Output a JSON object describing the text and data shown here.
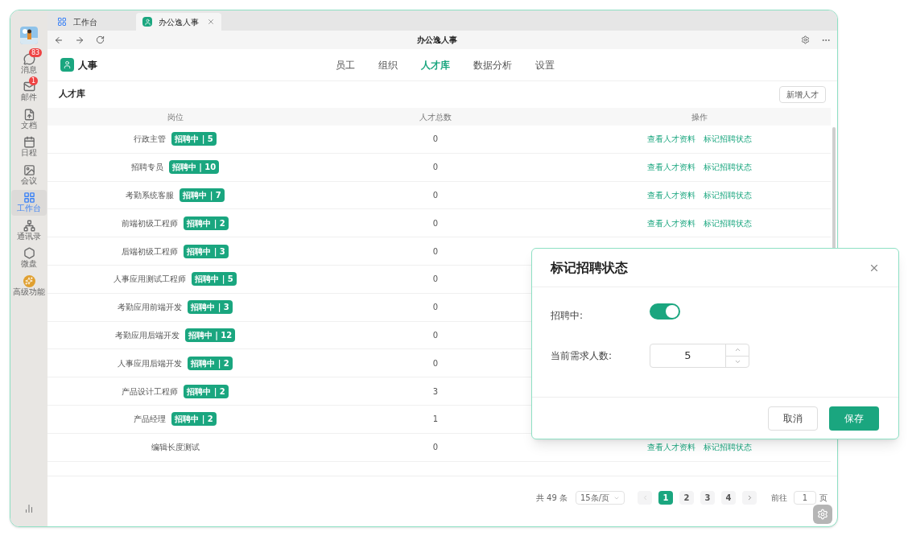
{
  "browser": {
    "tabs": [
      {
        "label": "工作台",
        "selected": false
      },
      {
        "label": "办公逸人事",
        "selected": true
      }
    ],
    "title": "办公逸人事"
  },
  "sidebar": {
    "items": [
      {
        "label": "消息",
        "badge": "83",
        "selected": false
      },
      {
        "label": "邮件",
        "badge": "1",
        "selected": false
      },
      {
        "label": "文档",
        "selected": false
      },
      {
        "label": "日程",
        "selected": false
      },
      {
        "label": "会议",
        "selected": false
      },
      {
        "label": "工作台",
        "selected": true
      },
      {
        "label": "通讯录",
        "selected": false
      },
      {
        "label": "微盘",
        "selected": false
      },
      {
        "label": "高级功能",
        "selected": false
      }
    ]
  },
  "app": {
    "name": "人事",
    "nav": [
      {
        "label": "员工",
        "selected": false
      },
      {
        "label": "组织",
        "selected": false
      },
      {
        "label": "人才库",
        "selected": true
      },
      {
        "label": "数据分析",
        "selected": false
      },
      {
        "label": "设置",
        "selected": false
      }
    ]
  },
  "page": {
    "title": "人才库",
    "add_button": "新增人才"
  },
  "table": {
    "columns": [
      "岗位",
      "人才总数",
      "操作"
    ],
    "rows": [
      {
        "position": "行政主管",
        "tag": "招聘中 | 5",
        "total": "0",
        "actions": [
          "查看人才资料",
          "标记招聘状态"
        ]
      },
      {
        "position": "招聘专员",
        "tag": "招聘中 | 10",
        "total": "0",
        "actions": [
          "查看人才资料",
          "标记招聘状态"
        ]
      },
      {
        "position": "考勤系统客服",
        "tag": "招聘中 | 7",
        "total": "0",
        "actions": [
          "查看人才资料",
          "标记招聘状态"
        ]
      },
      {
        "position": "前端初级工程师",
        "tag": "招聘中 | 2",
        "total": "0",
        "actions": [
          "查看人才资料",
          "标记招聘状态"
        ]
      },
      {
        "position": "后端初级工程师",
        "tag": "招聘中 | 3",
        "total": "0"
      },
      {
        "position": "人事应用测试工程师",
        "tag": "招聘中 | 5",
        "total": "0"
      },
      {
        "position": "考勤应用前端开发",
        "tag": "招聘中 | 3",
        "total": "0"
      },
      {
        "position": "考勤应用后端开发",
        "tag": "招聘中 | 12",
        "total": "0"
      },
      {
        "position": "人事应用后端开发",
        "tag": "招聘中 | 2",
        "total": "0"
      },
      {
        "position": "产品设计工程师",
        "tag": "招聘中 | 2",
        "total": "3"
      },
      {
        "position": "产品经理",
        "tag": "招聘中 | 2",
        "total": "1"
      },
      {
        "position": "编辑长度测试",
        "total": "0",
        "actions": [
          "查看人才资料",
          "标记招聘状态"
        ]
      }
    ]
  },
  "pagination": {
    "total": "共 49 条",
    "page_size": "15条/页",
    "pages": [
      {
        "label": "1",
        "selected": true
      },
      {
        "label": "2",
        "selected": false
      },
      {
        "label": "3",
        "selected": false
      },
      {
        "label": "4",
        "selected": false
      }
    ],
    "goto_label": "前往",
    "goto_value": "1",
    "goto_unit": "页"
  },
  "dialog": {
    "title": "标记招聘状态",
    "fields": [
      {
        "kind": "switch",
        "label": "招聘中:",
        "on": true
      },
      {
        "kind": "number",
        "label": "当前需求人数:",
        "value": "5"
      }
    ],
    "buttons": [
      {
        "label": "取消",
        "kind": "secondary"
      },
      {
        "label": "保存",
        "kind": "primary"
      }
    ]
  }
}
